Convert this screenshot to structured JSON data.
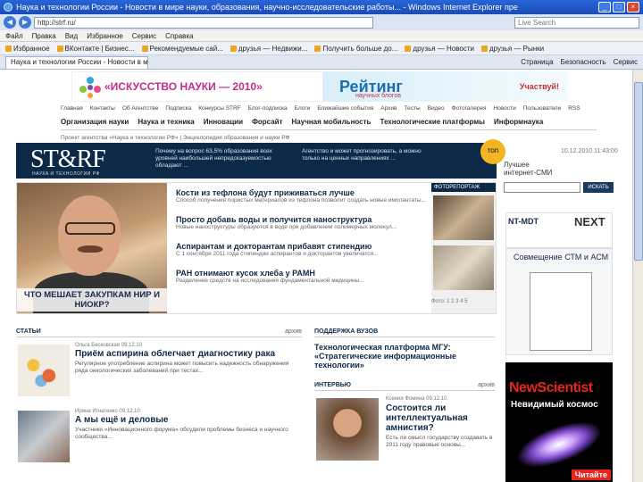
{
  "window": {
    "title": "Наука и технологии России - Новости в мире науки, образования, научно-исследовательские работы... - Windows Internet Explorer пре",
    "url": "http://strf.ru/",
    "search_placeholder": "Live Search",
    "min": "_",
    "max": "□",
    "close": "×"
  },
  "menu": [
    "Файл",
    "Правка",
    "Вид",
    "Избранное",
    "Сервис",
    "Справка"
  ],
  "favorites": [
    "Избранное",
    "ВКонтакте | Бизнес...",
    "Рекомендуемые сай...",
    "друзья — Недвижи...",
    "Получить больше до...",
    "друзья — Новости",
    "друзья — Рынки"
  ],
  "tab": {
    "label": "Наука и технологии России - Новости в мире на..."
  },
  "tab_tools": [
    "Страница",
    "Безопасность",
    "Сервис"
  ],
  "banner": {
    "art": "«ИСКУССТВО НАУКИ — 2010»",
    "rating": "Рейтинг",
    "rating_sub": "научных блогов",
    "participate": "Участвуй!"
  },
  "topnav": [
    "Главная",
    "Контакты",
    "Об Агентстве",
    "Подписка",
    "Конкурсы STRF",
    "Блог-подписка",
    "Блоги",
    "Ближайшие события",
    "Архив",
    "Тесты",
    "Видео",
    "Фотогалерея",
    "Новости",
    "Пользователи",
    "RSS"
  ],
  "mainnav": [
    "Организация науки",
    "Наука и техника",
    "Инновации",
    "Форсайт",
    "Научная мобильность",
    "Технологические платформы",
    "Информнаука"
  ],
  "breadcrumb": "Проект агентства «Наука и технологии РФ» | Энциклопедия образования и науки РФ",
  "header": {
    "logo": "ST&RF",
    "logo_sub": "НАУКА И ТЕХНОЛОГИИ РФ",
    "text_a": "Почему на вопрос 63,5% образования всех уровней наибольшей непредсказуемостью обладают ...",
    "text_b": "Агентство и может прогнозировать, а можно только на ценных направлениях ...",
    "badge": "ТОП",
    "best_line1": "Лучшее",
    "best_line2": "интернет-СМИ",
    "date": "10.12.2010  11:43:00",
    "search_btn": "ИСКАТЬ"
  },
  "feature": {
    "caption": "ЧТО МЕШАЕТ ЗАКУПКАМ НИР И НИОКР?",
    "items": [
      {
        "title": "Кости из тефлона будут приживаться лучше",
        "desc": "Способ получения пористых материалов из тефлона позволит создать новые имплантаты..."
      },
      {
        "title": "Просто добавь воды и получится наноструктура",
        "desc": "Новые наноструктуры образуются в воде при добавлении полимерных молекул..."
      },
      {
        "title": "Аспирантам и докторантам прибавят стипендию",
        "desc": "С 1 сентября 2011 года стипендии аспирантов и докторантов увеличатся..."
      },
      {
        "title": "РАН отнимают кусок хлеба у РАМН",
        "desc": "Разделение средств на исследования фундаментальной медицины..."
      }
    ],
    "side_head": "ФОТОРЕПОРТАЖ",
    "side_foot": "Фото: 1 2 3 4 5"
  },
  "ads": {
    "ntmdt": "NT-MDT",
    "next": "NEXT",
    "stm": "Совмещение СТМ и АСМ",
    "ns_logo": "NewScientist",
    "ns_sub": "Невидимый космос",
    "ns_read": "Читайте"
  },
  "articles_section": {
    "head": "СТАТЬИ",
    "all": "архив",
    "items": [
      {
        "date": "Ольга Бесковская\n09.12.10",
        "title": "Приём аспирина облегчает диагностику рака",
        "desc": "Регулярное употребление аспирина может повысить надежность обнаружения ряда онкологических заболеваний при тестах..."
      },
      {
        "date": "Ирина Игнатенко\n09.12.10",
        "title": "А мы ещё и деловые",
        "desc": "Участники «Инновационного форума» обсудили проблемы бизнеса и научного сообщества..."
      }
    ]
  },
  "support_section": {
    "head": "ПОДДЕРЖКА ВУЗОВ",
    "title": "Технологическая платформа МГУ: «Стратегические информационные технологии»"
  },
  "interview_section": {
    "head": "ИНТЕРВЬЮ",
    "all": "архив",
    "date": "Ксения Фомина\n09.12.10",
    "title": "Состоится ли интеллектуальная амнистия?",
    "desc": "Есть ли смысл государству создавать в 2011 году правовые основы..."
  }
}
